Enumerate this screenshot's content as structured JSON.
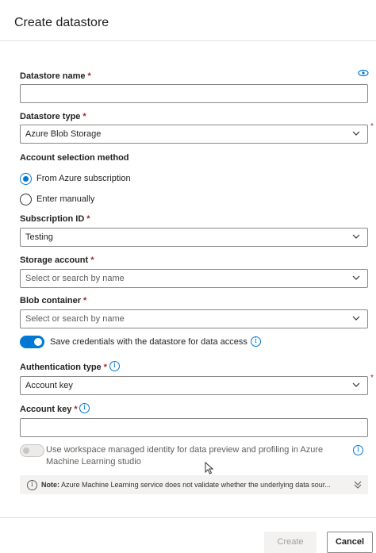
{
  "header": {
    "title": "Create datastore"
  },
  "form": {
    "datastore_name": {
      "label": "Datastore name",
      "required": "*",
      "value": ""
    },
    "datastore_type": {
      "label": "Datastore type",
      "required": "*",
      "value": "Azure Blob Storage",
      "outside_required": "*"
    },
    "account_selection": {
      "label": "Account selection method",
      "options": [
        "From Azure subscription",
        "Enter manually"
      ],
      "selected": "From Azure subscription"
    },
    "subscription_id": {
      "label": "Subscription ID",
      "required": "*",
      "value": "Testing"
    },
    "storage_account": {
      "label": "Storage account",
      "required": "*",
      "placeholder": "Select or search by name"
    },
    "blob_container": {
      "label": "Blob container",
      "required": "*",
      "placeholder": "Select or search by name"
    },
    "save_credentials": {
      "label": "Save credentials with the datastore for data access",
      "on": true
    },
    "authentication_type": {
      "label": "Authentication type",
      "required": "*",
      "value": "Account key",
      "outside_required": "*"
    },
    "account_key": {
      "label": "Account key",
      "required": "*",
      "value": ""
    },
    "workspace_identity": {
      "label_line1": "Use workspace managed identity for data preview and profiling in Azure",
      "label_line2": "Machine Learning studio",
      "on": false
    },
    "note": {
      "prefix": "Note:",
      "text": "Azure Machine Learning service does not validate whether the underlying data sour..."
    }
  },
  "footer": {
    "create_label": "Create",
    "cancel_label": "Cancel"
  },
  "colors": {
    "accent": "#0078d4",
    "required": "#a4262c",
    "border": "#8a8886"
  },
  "icons": {
    "chevron": "chevron-down-icon",
    "info": "info-icon",
    "eye": "eye-icon",
    "expand": "double-chevron-down-icon"
  }
}
